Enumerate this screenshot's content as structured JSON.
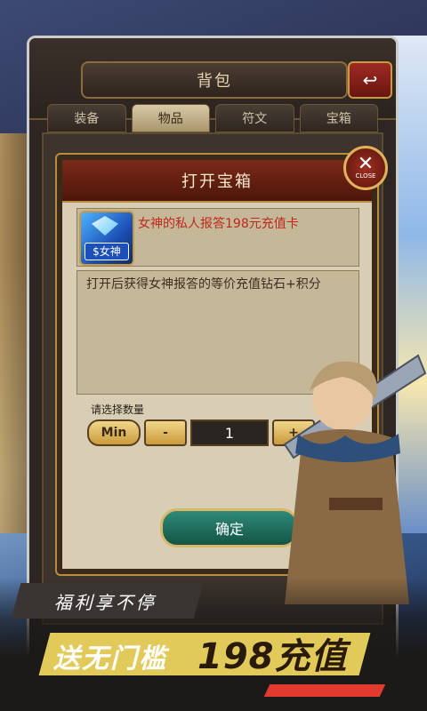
{
  "inventory": {
    "title": "背包",
    "tabs": [
      {
        "label": "装备",
        "active": false
      },
      {
        "label": "物品",
        "active": true
      },
      {
        "label": "符文",
        "active": false
      },
      {
        "label": "宝箱",
        "active": false
      }
    ]
  },
  "dialog": {
    "title": "打开宝箱",
    "close_label": "CLOSE",
    "item_name": "女神的私人报答198元充值卡",
    "icon_label": "$女神",
    "description": "打开后获得女神报答的等价充值钻石+积分",
    "quantity_label": "请选择数量",
    "min_label": "Min",
    "minus_label": "-",
    "quantity_value": "1",
    "plus_label": "+",
    "confirm_label": "确定"
  },
  "promo": {
    "line1": "福利享不停",
    "line2_left": "送无门槛",
    "line2_right": "198充值"
  },
  "colors": {
    "item_name": "#c0281c",
    "promo_bar": "#e2ca5a",
    "dialog_header": "#7a2a18"
  }
}
